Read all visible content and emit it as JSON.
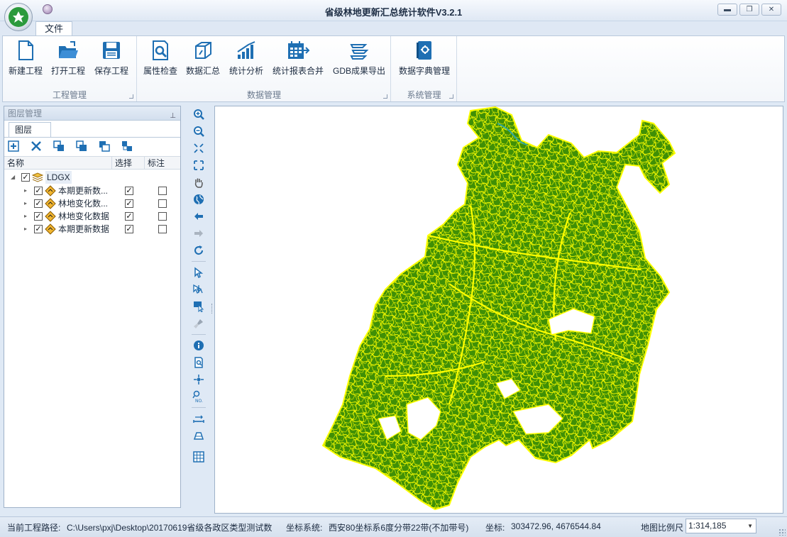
{
  "app": {
    "title": "省级林地更新汇总统计软件V3.2.1",
    "window_controls": {
      "minimize": "▬",
      "maximize": "❐",
      "close": "✕"
    }
  },
  "tabs": [
    {
      "label": "文件",
      "active": true
    }
  ],
  "ribbon": {
    "groups": [
      {
        "label": "工程管理",
        "buttons": [
          {
            "label": "新建工程",
            "icon": "new-file-icon"
          },
          {
            "label": "打开工程",
            "icon": "open-folder-icon"
          },
          {
            "label": "保存工程",
            "icon": "save-disk-icon"
          }
        ]
      },
      {
        "label": "数据管理",
        "buttons": [
          {
            "label": "属性检查",
            "icon": "attribute-check-icon"
          },
          {
            "label": "数据汇总",
            "icon": "data-summary-icon"
          },
          {
            "label": "统计分析",
            "icon": "bar-chart-icon"
          },
          {
            "label": "统计报表合并",
            "icon": "report-merge-icon"
          },
          {
            "label": "GDB成果导出",
            "icon": "gdb-export-icon"
          }
        ]
      },
      {
        "label": "系统管理",
        "buttons": [
          {
            "label": "数据字典管理",
            "icon": "dictionary-icon"
          }
        ]
      }
    ]
  },
  "layer_panel": {
    "title": "图层管理",
    "tab": "图层",
    "toolbar_icons": [
      "add-layer-icon",
      "delete-layer-icon",
      "copy-layer-icon",
      "move-up-icon",
      "move-down-icon",
      "group-layer-icon"
    ],
    "columns": {
      "name": "名称",
      "select": "选择",
      "label": "标注"
    },
    "root": {
      "name": "LDGX",
      "checked": true,
      "expanded": true
    },
    "layers": [
      {
        "name": "本期更新数...",
        "visible": true,
        "selectable": true,
        "labeled": false
      },
      {
        "name": "林地变化数...",
        "visible": true,
        "selectable": true,
        "labeled": false
      },
      {
        "name": "林地变化数据",
        "visible": true,
        "selectable": true,
        "labeled": false
      },
      {
        "name": "本期更新数据",
        "visible": true,
        "selectable": true,
        "labeled": false
      }
    ]
  },
  "map_tools": [
    "zoom-in-icon",
    "zoom-out-icon",
    "fixed-zoom-in-icon",
    "fixed-zoom-out-icon",
    "pan-hand-icon",
    "full-extent-globe-icon",
    "back-arrow-icon",
    "forward-arrow-icon",
    "refresh-icon",
    "select-arrow-icon",
    "select-multiple-icon",
    "select-rectangle-icon",
    "clear-brush-icon",
    "identify-info-icon",
    "attribute-query-icon",
    "locate-point-icon",
    "query-number-icon",
    "measure-distance-icon",
    "measure-area-icon",
    "grid-icon"
  ],
  "map": {
    "fill_color": "#3f8f06",
    "boundary_color": "#ffff00"
  },
  "status": {
    "project_path_label": "当前工程路径:",
    "project_path": "C:\\Users\\pxj\\Desktop\\20170619省级各政区类型测试数",
    "crs_label": "坐标系统:",
    "crs": "西安80坐标系6度分带22带(不加带号)",
    "coord_label": "坐标:",
    "coord": "303472.96, 4676544.84",
    "scale_label": "地图比例尺",
    "scale": "1:314,185"
  }
}
